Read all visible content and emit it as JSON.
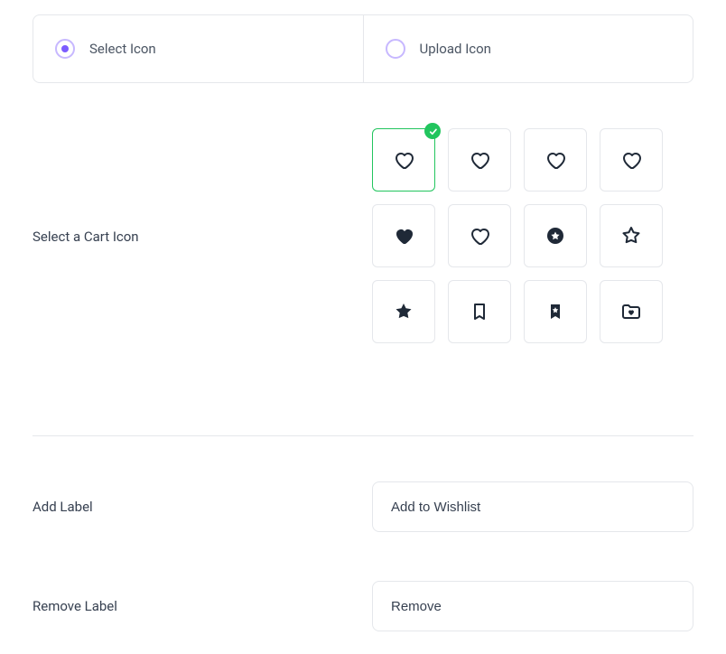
{
  "tabs": {
    "select_label": "Select Icon",
    "upload_label": "Upload Icon",
    "selected": "select"
  },
  "iconSection": {
    "label": "Select a Cart Icon",
    "selectedIndex": 0,
    "icons": [
      "heart-outline",
      "heart-outline",
      "heart-outline",
      "heart-outline",
      "heart-filled",
      "heart-outline",
      "star-circle-filled",
      "star-outline",
      "star-filled",
      "bookmark-outline",
      "bookmark-star-filled",
      "folder-heart"
    ]
  },
  "addLabel": {
    "label": "Add Label",
    "value": "Add to Wishlist"
  },
  "removeLabel": {
    "label": "Remove Label",
    "value": "Remove"
  }
}
